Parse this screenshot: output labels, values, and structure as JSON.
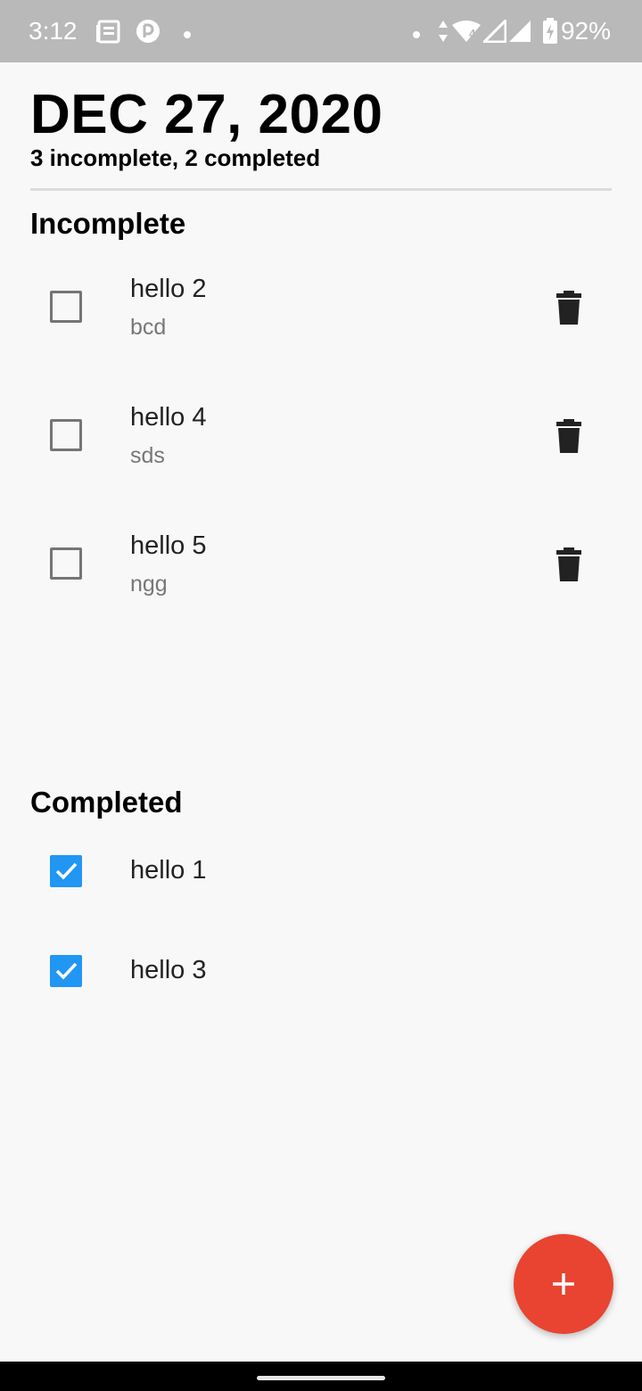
{
  "status_bar": {
    "time": "3:12",
    "battery_percent": "92%",
    "network_label": "4",
    "icons": [
      "news-icon",
      "pocket-casts-icon",
      "notification-dot-icon",
      "data-arrows-icon",
      "wifi-icon",
      "signal-icon",
      "signal-icon",
      "battery-charging-icon"
    ]
  },
  "header": {
    "date": "DEC 27, 2020",
    "summary": "3 incomplete, 2 completed"
  },
  "incomplete": {
    "title": "Incomplete",
    "items": [
      {
        "title": "hello 2",
        "subtitle": "bcd",
        "checked": false
      },
      {
        "title": "hello 4",
        "subtitle": "sds",
        "checked": false
      },
      {
        "title": "hello 5",
        "subtitle": "ngg",
        "checked": false
      }
    ]
  },
  "completed": {
    "title": "Completed",
    "items": [
      {
        "title": "hello 1",
        "checked": true
      },
      {
        "title": "hello 3",
        "checked": true
      }
    ]
  },
  "fab": {
    "icon": "plus-icon"
  },
  "colors": {
    "accent_checkbox": "#2196f3",
    "fab": "#e84431",
    "status_bar": "#b9b9b9",
    "background": "#f8f8f8"
  }
}
